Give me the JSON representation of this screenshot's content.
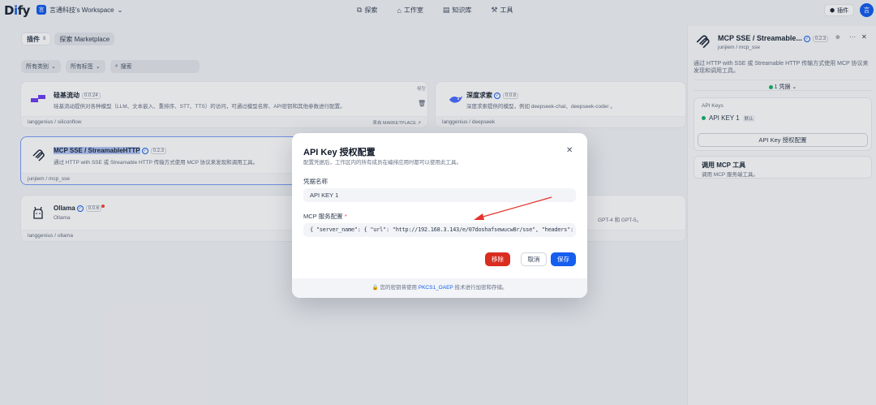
{
  "app": {
    "logo_main": "D",
    "logo_i": "i",
    "logo_rest": "fy",
    "workspace_badge": "言",
    "workspace": "言通科技's Workspace"
  },
  "nav": [
    {
      "label": "探索",
      "icon": "⧉"
    },
    {
      "label": "工作室",
      "icon": "⌂"
    },
    {
      "label": "知识库",
      "icon": "▤"
    },
    {
      "label": "工具",
      "icon": "⚒"
    }
  ],
  "header_right": {
    "plugin": "插件",
    "avatar": "言"
  },
  "tabs": {
    "plugins": "插件",
    "plugins_count": "8",
    "marketplace": "探索 Marketplace"
  },
  "filters": {
    "category": "所有类别",
    "tags": "所有标签",
    "search_placeholder": "搜索"
  },
  "cards": {
    "silicon": {
      "title": "硅基流动",
      "version": "0.0.24",
      "desc": "硅基流动提供对各种模型（LLM、文本嵌入、重排序、STT、TTS）的访问，可通过模型名称、API密钥和其他参数进行配置。",
      "author": "langgenius / siliconflow",
      "badge": "模型",
      "from": "来自 MARKETPLACE ↗"
    },
    "deepseek": {
      "title": "深度求索",
      "version": "0.0.6",
      "desc": "深度求索提供的模型，例如 deepseek-chat、deepseek-coder 。",
      "author": "langgenius / deepseek"
    },
    "mcp": {
      "title": "MCP SSE / StreamableHTTP",
      "version": "0.2.3",
      "desc": "通过 HTTP with SSE 或 Streamable HTTP 传输方式使用 MCP 协议来发现和调用工具。",
      "author": "junjiem / mcp_sse"
    },
    "ollama": {
      "title": "Ollama",
      "version": "0.0.6",
      "desc": "Ollama",
      "author": "langgenius / ollama"
    },
    "gpt": {
      "desc": "GPT-4 和 GPT-5。"
    }
  },
  "panel": {
    "title": "MCP SSE / Streamable...",
    "version": "0.2.3",
    "subtitle": "junjiem / mcp_sse",
    "desc": "通过 HTTP with SSE 或 Streamable HTTP 传输方式使用 MCP 协议来发现和调用工具。",
    "credentials": "1 凭据",
    "api_keys_label": "API Keys",
    "api_key_name": "API KEY 1",
    "default_tag": "默认",
    "config_button": "API Key 授权配置",
    "tool_title": "调用 MCP 工具",
    "tool_desc": "调用 MCP 服务端工具。"
  },
  "modal": {
    "title": "API Key 授权配置",
    "desc": "配置凭据后，工作区内的所有成员在编排应用时都可以使用此工具。",
    "name_label": "凭据名称",
    "name_value": "API KEY 1",
    "config_label": "MCP 服务配置",
    "required": "*",
    "config_value": "{  \"server_name\": {    \"url\": \"http://192.168.3.143/e/07doshafsewucw8r/sse\",    \"headers\": {},",
    "remove": "移除",
    "cancel": "取消",
    "save": "保存",
    "footer_prefix": "您的密钥将使用",
    "footer_link": "PKCS1_OAEP",
    "footer_suffix": "技术进行加密和存储。"
  }
}
